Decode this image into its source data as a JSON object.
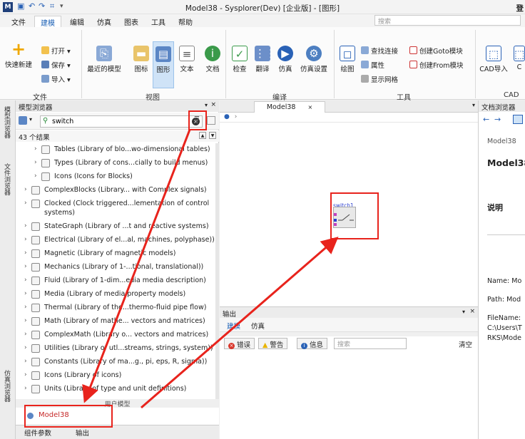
{
  "window": {
    "title": "Model38 - Sysplorer(Dev) [企业版] - [图形]",
    "title_right": "登"
  },
  "menu": {
    "tabs": [
      "文件",
      "建模",
      "编辑",
      "仿真",
      "图表",
      "工具",
      "帮助"
    ],
    "active": "建模",
    "search_placeholder": "搜索"
  },
  "ribbon": {
    "file_group": {
      "label": "文件",
      "quick_new": "快速新建",
      "open": "打开",
      "save": "保存",
      "import": "导入"
    },
    "view_group": {
      "label": "视图",
      "recent_models": "最近的模型",
      "icon": "图标",
      "diagram": "图形",
      "text": "文本",
      "doc": "文档"
    },
    "compile_group": {
      "label": "编译",
      "check": "检查",
      "translate": "翻译",
      "simulate": "仿真",
      "sim_settings": "仿真设置"
    },
    "tools_group": {
      "label": "工具",
      "draw": "绘图",
      "find_connection": "查找连接",
      "attributes": "属性",
      "show_grid": "显示网格",
      "create_goto": "创建Goto模块",
      "create_from": "创建From模块"
    },
    "cad_group": {
      "label": "CAD",
      "cad_import": "CAD导入",
      "cad_short": "C"
    }
  },
  "side_tabs": [
    "模型浏览器",
    "文件浏览器",
    "仿真浏览器"
  ],
  "model_browser": {
    "title": "模型浏览器",
    "search_value": "switch",
    "result_count": "43 个结果",
    "items": [
      {
        "label": "Tables (Library of blo...wo-dimensional tables)",
        "indent": 1
      },
      {
        "label": "Types (Library of cons...cially to build menus)",
        "indent": 1
      },
      {
        "label": "Icons (Icons for Blocks)",
        "indent": 1
      },
      {
        "label": "ComplexBlocks (Library... with Complex signals)",
        "indent": 0
      },
      {
        "label": "Clocked (Clock triggered...lementation of control",
        "label2": "systems)",
        "indent": 0
      },
      {
        "label": "StateGraph (Library of ...t and reactive systems)",
        "indent": 0
      },
      {
        "label": "Electrical (Library of el...al, machines, polyphase))",
        "indent": 0
      },
      {
        "label": "Magnetic (Library of magnetic models)",
        "indent": 0
      },
      {
        "label": "Mechanics (Library of 1-...tional, translational))",
        "indent": 0
      },
      {
        "label": "Fluid (Library of 1-dim...edia media description)",
        "indent": 0
      },
      {
        "label": "Media (Library of media property models)",
        "indent": 0
      },
      {
        "label": "Thermal (Library of the...thermo-fluid pipe flow)",
        "indent": 0
      },
      {
        "label": "Math (Library of mathe... vectors and matrices)",
        "indent": 0
      },
      {
        "label": "ComplexMath (Library o... vectors and matrices)",
        "indent": 0
      },
      {
        "label": "Utilities (Library of utl...streams, strings, system))",
        "indent": 0
      },
      {
        "label": "Constants (Library of ma...g., pi, eps, R, sigma))",
        "indent": 0
      },
      {
        "label": "Icons (Library of icons)",
        "indent": 0
      },
      {
        "label": "Units (Library of type and unit definitions)",
        "indent": 0
      }
    ],
    "user_models_header": "用户模型",
    "user_model": "Model38"
  },
  "bottom_tabs": [
    "组件参数",
    "输出"
  ],
  "editor": {
    "tab_label": "Model38",
    "component_name": "switch1"
  },
  "output": {
    "title": "输出",
    "tabs": [
      "建模",
      "仿真"
    ],
    "filters": {
      "error": "错误",
      "warning": "警告",
      "info": "信息"
    },
    "search_placeholder": "搜索",
    "clear": "清空"
  },
  "doc_browser": {
    "title": "文档浏览器",
    "model_name": "Model38",
    "model_heading": "Model38",
    "description": "说明",
    "name_line": "Name: Mo",
    "path_line": "Path: Mod",
    "filename_line": "FileName:",
    "filename_path1": "C:\\Users\\T",
    "filename_path2": "RKS\\Mode"
  },
  "colors": {
    "accent": "#1a5fb4",
    "annotation_red": "#e8231c",
    "error_badge": "#d9362b",
    "warning_badge": "#e8b400",
    "info_badge": "#2a62b6"
  }
}
